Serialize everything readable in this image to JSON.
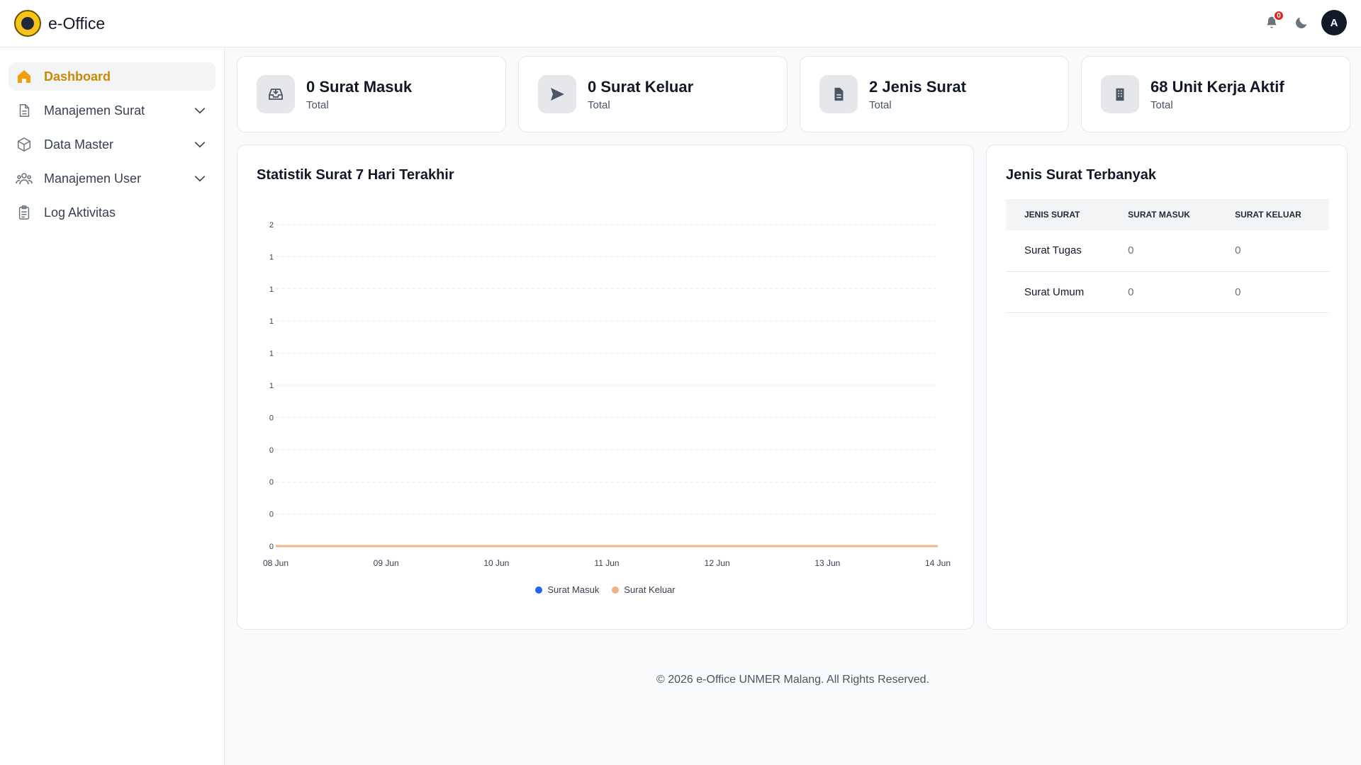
{
  "app": {
    "title": "e-Office"
  },
  "header": {
    "notification_count": "0",
    "avatar_initial": "A"
  },
  "sidebar": {
    "items": [
      {
        "label": "Dashboard",
        "icon": "home-icon",
        "active": true
      },
      {
        "label": "Manajemen Surat",
        "icon": "document-icon",
        "expandable": true
      },
      {
        "label": "Data Master",
        "icon": "cube-icon",
        "expandable": true
      },
      {
        "label": "Manajemen User",
        "icon": "users-icon",
        "expandable": true
      },
      {
        "label": "Log Aktivitas",
        "icon": "clipboard-icon"
      }
    ]
  },
  "stats": [
    {
      "title": "0 Surat Masuk",
      "subtitle": "Total",
      "icon": "inbox-icon"
    },
    {
      "title": "0 Surat Keluar",
      "subtitle": "Total",
      "icon": "send-icon"
    },
    {
      "title": "2 Jenis Surat",
      "subtitle": "Total",
      "icon": "file-icon"
    },
    {
      "title": "68 Unit Kerja Aktif",
      "subtitle": "Total",
      "icon": "building-icon"
    }
  ],
  "chart_card": {
    "title": "Statistik Surat 7 Hari Terakhir"
  },
  "chart_data": {
    "type": "line",
    "title": "Statistik Surat 7 Hari Terakhir",
    "categories": [
      "08 Jun",
      "09 Jun",
      "10 Jun",
      "11 Jun",
      "12 Jun",
      "13 Jun",
      "14 Jun"
    ],
    "y_tick_labels": [
      "0",
      "0",
      "0",
      "0",
      "0",
      "1",
      "1",
      "1",
      "1",
      "1",
      "2"
    ],
    "ylim": [
      0,
      2
    ],
    "series": [
      {
        "name": "Surat Masuk",
        "values": [
          0,
          0,
          0,
          0,
          0,
          0,
          0
        ],
        "color": "#2563eb"
      },
      {
        "name": "Surat Keluar",
        "values": [
          0,
          0,
          0,
          0,
          0,
          0,
          0
        ],
        "color": "#f4b183"
      }
    ],
    "grid": true,
    "legend": "bottom"
  },
  "table_card": {
    "title": "Jenis Surat Terbanyak",
    "columns": [
      "JENIS SURAT",
      "SURAT MASUK",
      "SURAT KELUAR"
    ],
    "rows": [
      [
        "Surat Tugas",
        "0",
        "0"
      ],
      [
        "Surat Umum",
        "0",
        "0"
      ]
    ]
  },
  "footer": {
    "text": "© 2026 e-Office UNMER Malang. All Rights Reserved."
  },
  "colors": {
    "accent": "#ca8a04",
    "badge": "#dc2626"
  }
}
